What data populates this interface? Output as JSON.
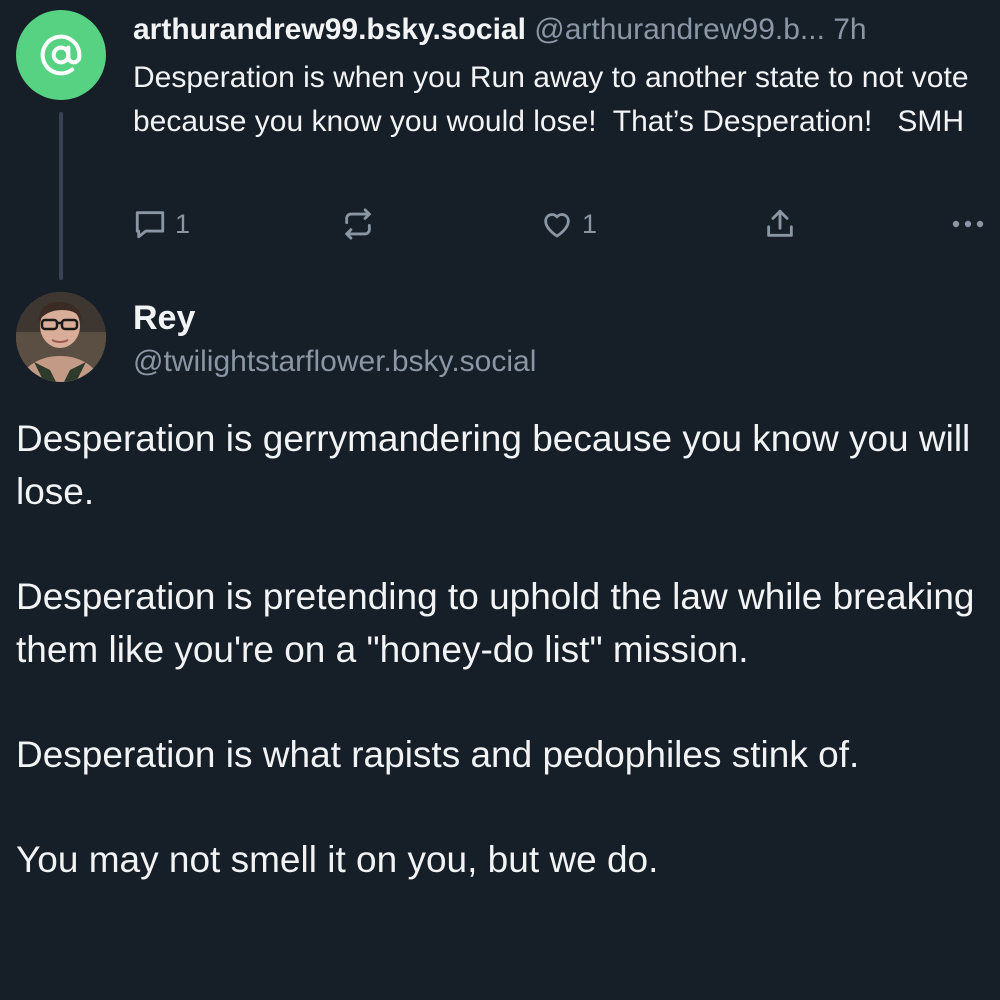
{
  "parent_post": {
    "avatar_icon": "at-sign-icon",
    "avatar_color": "#56d282",
    "display_name": "arthurandrew99.bsky.social",
    "handle": " @arthurandrew99.b...",
    "time": " 7h",
    "text": "Desperation is when you Run away to another state to not vote because you know you would lose!  That’s Desperation!   SMH",
    "actions": {
      "reply_icon": "comment-icon",
      "reply_count": "1",
      "repost_icon": "repost-icon",
      "like_icon": "heart-icon",
      "like_count": "1",
      "share_icon": "share-icon",
      "more_icon": "more-options-icon"
    }
  },
  "reply_post": {
    "display_name": "Rey",
    "handle": "@twilightstarflower.bsky.social",
    "paragraphs": [
      "Desperation is gerrymandering because you know you will lose.",
      "Desperation is pretending to uphold the law while breaking them like you're on a \"honey-do list\" mission.",
      "Desperation is what rapists and pedophiles stink of.",
      "You may not smell it on you, but we do."
    ]
  },
  "colors": {
    "background": "#161e27",
    "text_primary": "#f1f3f5",
    "text_secondary": "#8a96a3",
    "thread_line": "#39434f"
  }
}
